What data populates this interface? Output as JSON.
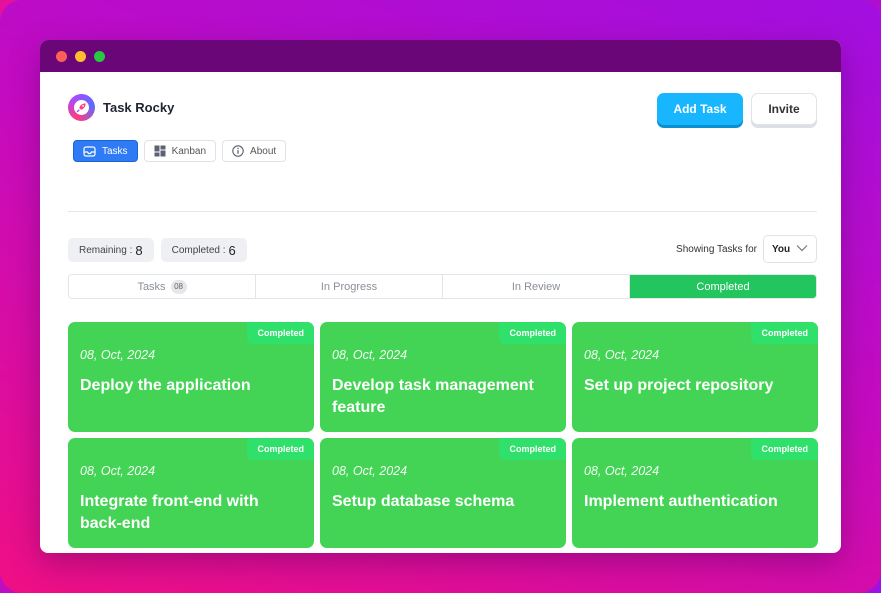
{
  "app": {
    "name": "Task Rocky"
  },
  "actions": {
    "add_task": "Add Task",
    "invite": "Invite"
  },
  "view_tabs": [
    {
      "label": "Tasks",
      "icon": "inbox-icon",
      "active": true
    },
    {
      "label": "Kanban",
      "icon": "grid-icon",
      "active": false
    },
    {
      "label": "About",
      "icon": "info-icon",
      "active": false
    }
  ],
  "counts": {
    "remaining_label": "Remaining :",
    "remaining_value": "8",
    "completed_label": "Completed :",
    "completed_value": "6"
  },
  "filter": {
    "label": "Showing Tasks for",
    "selected": "You"
  },
  "status_tabs": [
    {
      "label": "Tasks",
      "badge": "08",
      "active": false
    },
    {
      "label": "In Progress",
      "active": false
    },
    {
      "label": "In Review",
      "active": false
    },
    {
      "label": "Completed",
      "active": true
    }
  ],
  "cards": [
    {
      "badge": "Completed",
      "date": "08, Oct, 2024",
      "title": "Deploy the application"
    },
    {
      "badge": "Completed",
      "date": "08, Oct, 2024",
      "title": "Develop task management feature"
    },
    {
      "badge": "Completed",
      "date": "08, Oct, 2024",
      "title": "Set up project repository"
    },
    {
      "badge": "Completed",
      "date": "08, Oct, 2024",
      "title": "Integrate front-end with back-end"
    },
    {
      "badge": "Completed",
      "date": "08, Oct, 2024",
      "title": "Setup database schema"
    },
    {
      "badge": "Completed",
      "date": "08, Oct, 2024",
      "title": "Implement authentication"
    }
  ],
  "colors": {
    "accent_blue": "#17b6ff",
    "tab_active": "#2f7bf5",
    "completed_green": "#22c55e",
    "card_green": "#43d455",
    "titlebar": "#6a0678"
  }
}
